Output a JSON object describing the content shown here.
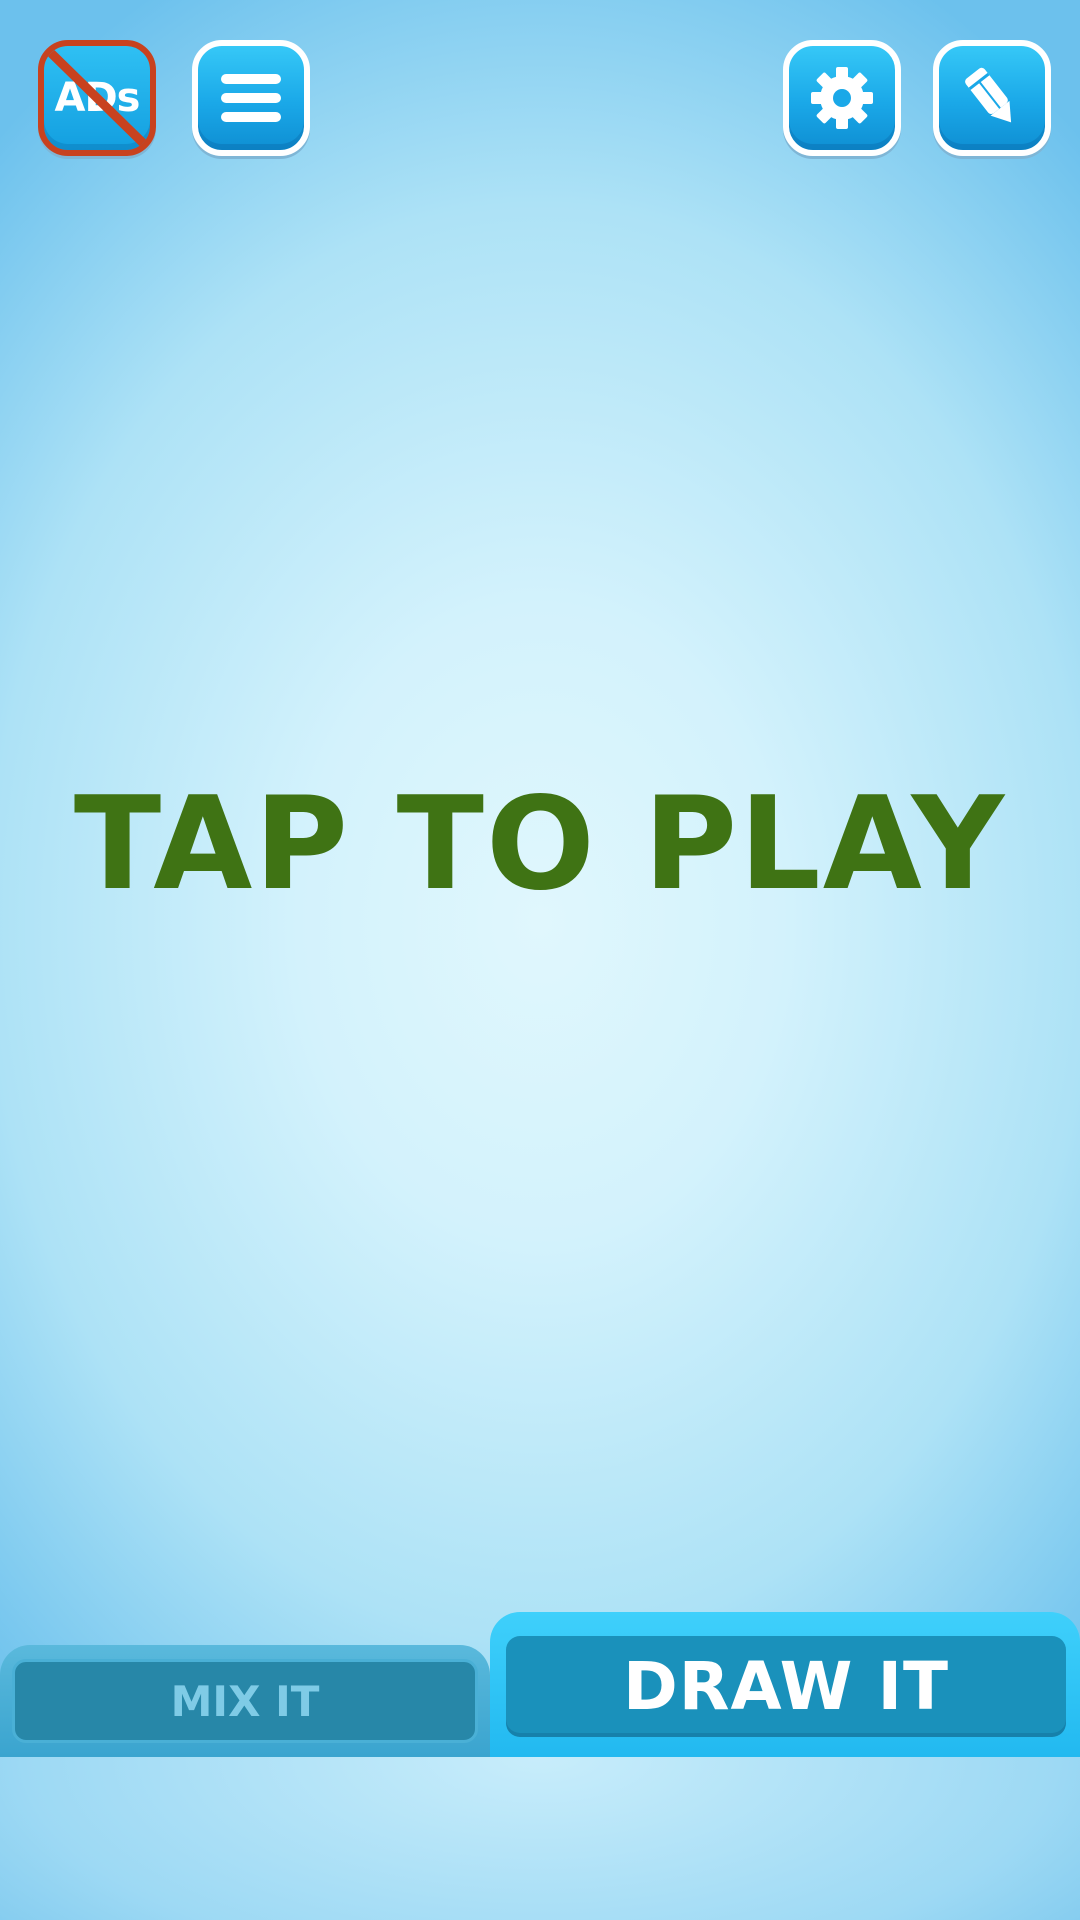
{
  "top_bar": {
    "no_ads_button": {
      "label": "ADs",
      "icon": "no-ads-icon"
    },
    "menu_button": {
      "icon": "hamburger-menu-icon"
    },
    "settings_button": {
      "icon": "gear-icon"
    },
    "edit_button": {
      "icon": "pencil-icon"
    }
  },
  "main": {
    "prompt": "TAP TO PLAY"
  },
  "tabs": [
    {
      "label": "MIX IT",
      "active": false
    },
    {
      "label": "DRAW IT",
      "active": true
    }
  ],
  "colors": {
    "prompt_text": "#3f7314",
    "button_blue": "#1aa8e8",
    "no_ads_slash": "#c8421f",
    "active_tab": "#22b9f0",
    "inactive_tab": "#3aa4cf"
  }
}
